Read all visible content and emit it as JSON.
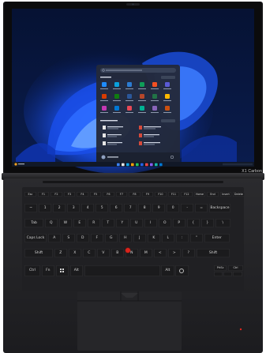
{
  "brand_label": "X1 Carbon",
  "keyboard": {
    "function_row": [
      "Esc",
      "F1",
      "F2",
      "F3",
      "F4",
      "F5",
      "F6",
      "F7",
      "F8",
      "F9",
      "F10",
      "F11",
      "F12",
      "Home",
      "End",
      "Insert",
      "Delete"
    ],
    "number_row": [
      "~",
      "1",
      "2",
      "3",
      "4",
      "5",
      "6",
      "7",
      "8",
      "9",
      "0",
      "-",
      "=",
      "Backspace"
    ],
    "qwerty_row": [
      "Tab",
      "Q",
      "W",
      "E",
      "R",
      "T",
      "Y",
      "U",
      "I",
      "O",
      "P",
      "{",
      "}",
      "\\"
    ],
    "home_row": [
      "Caps Lock",
      "A",
      "S",
      "D",
      "F",
      "G",
      "H",
      "J",
      "K",
      "L",
      ":",
      "\"",
      "Enter"
    ],
    "shift_row": [
      "Shift",
      "Z",
      "X",
      "C",
      "V",
      "B",
      "N",
      "M",
      "<",
      ">",
      "?",
      "Shift"
    ],
    "bottom_row": [
      "Ctrl",
      "Fn",
      "",
      "Alt",
      "",
      "Alt",
      "",
      "",
      "PrtSc",
      "Ctrl"
    ]
  },
  "icons": [
    "windows-logo-icon",
    "trackpoint-icon",
    "fingerprint-icon",
    "arrow-keys-icon"
  ]
}
